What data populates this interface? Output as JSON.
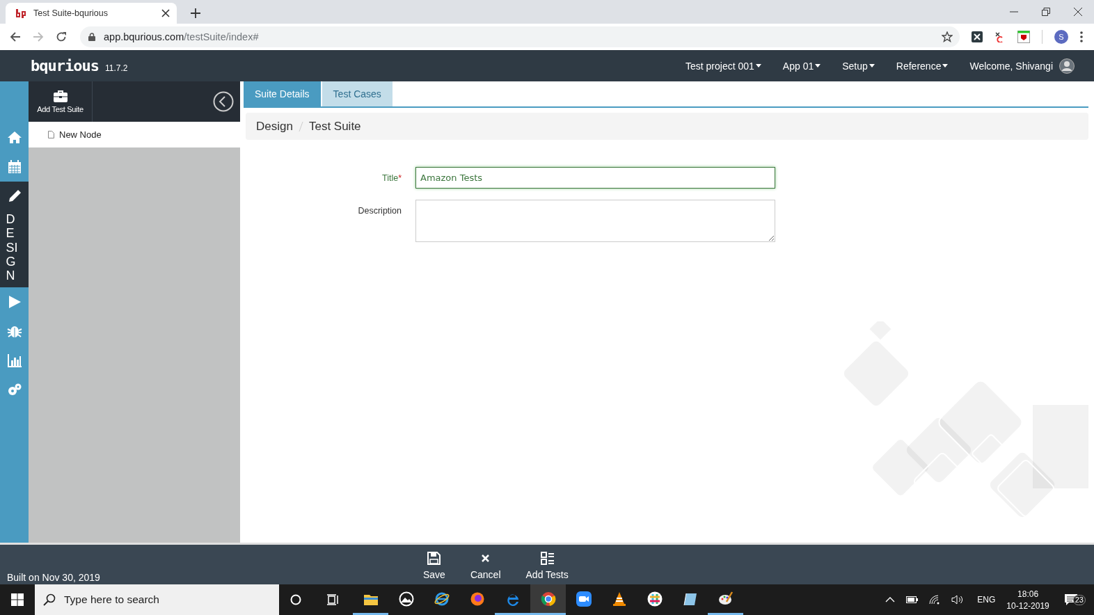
{
  "browser": {
    "tab": {
      "title": "Test Suite-bqurious"
    },
    "url": {
      "host": "app.bqurious.com",
      "path": "/testSuite/index#"
    },
    "profile": "S"
  },
  "header": {
    "logo": "bqurious",
    "version": "11.7.2",
    "menus": [
      {
        "label": "Test project 001"
      },
      {
        "label": "App 01"
      },
      {
        "label": "Setup"
      },
      {
        "label": "Reference"
      }
    ],
    "welcome": "Welcome, Shivangi"
  },
  "rail": [
    {
      "kind": "home",
      "selected": false
    },
    {
      "kind": "calendar",
      "selected": false
    },
    {
      "kind": "design",
      "selected": true,
      "label": "DESIGN"
    },
    {
      "kind": "play",
      "selected": false
    },
    {
      "kind": "bug",
      "selected": false
    },
    {
      "kind": "chart",
      "selected": false
    },
    {
      "kind": "gears",
      "selected": false
    }
  ],
  "side_panel": {
    "add_button": "Add Test Suite",
    "tree": [
      {
        "label": "New Node"
      }
    ]
  },
  "tabs": [
    {
      "label": "Suite Details",
      "selected": true
    },
    {
      "label": "Test Cases",
      "selected": false
    }
  ],
  "breadcrumb": [
    "Design",
    "Test Suite"
  ],
  "form": {
    "fields": [
      {
        "kind": "text",
        "label": "Title",
        "required_mark": "*",
        "value": "Amazon Tests",
        "focused": true
      },
      {
        "kind": "textarea",
        "label": "Description",
        "focused": false
      }
    ]
  },
  "footer": {
    "built": "Built on Nov 30, 2019",
    "actions": [
      {
        "kind": "save",
        "label": "Save"
      },
      {
        "kind": "cancel",
        "label": "Cancel"
      },
      {
        "kind": "add",
        "label": "Add Tests"
      }
    ]
  },
  "taskbar": {
    "search_placeholder": "Type here to search",
    "apps": [
      {
        "kind": "folder",
        "running": true,
        "selected": false
      },
      {
        "kind": "photos",
        "running": false,
        "selected": false
      },
      {
        "kind": "ie",
        "running": false,
        "selected": false
      },
      {
        "kind": "firefox",
        "running": false,
        "selected": false
      },
      {
        "kind": "edge",
        "running": true,
        "selected": false
      },
      {
        "kind": "chrome",
        "running": true,
        "selected": true
      },
      {
        "kind": "zoom",
        "running": false,
        "selected": false
      },
      {
        "kind": "vlc",
        "running": false,
        "selected": false
      },
      {
        "kind": "slack",
        "running": false,
        "selected": false
      },
      {
        "kind": "notes",
        "running": false,
        "selected": false
      },
      {
        "kind": "paint",
        "running": true,
        "selected": false
      }
    ],
    "language": "ENG",
    "time": "18:06",
    "date": "10-12-2019",
    "notifications": "23"
  }
}
